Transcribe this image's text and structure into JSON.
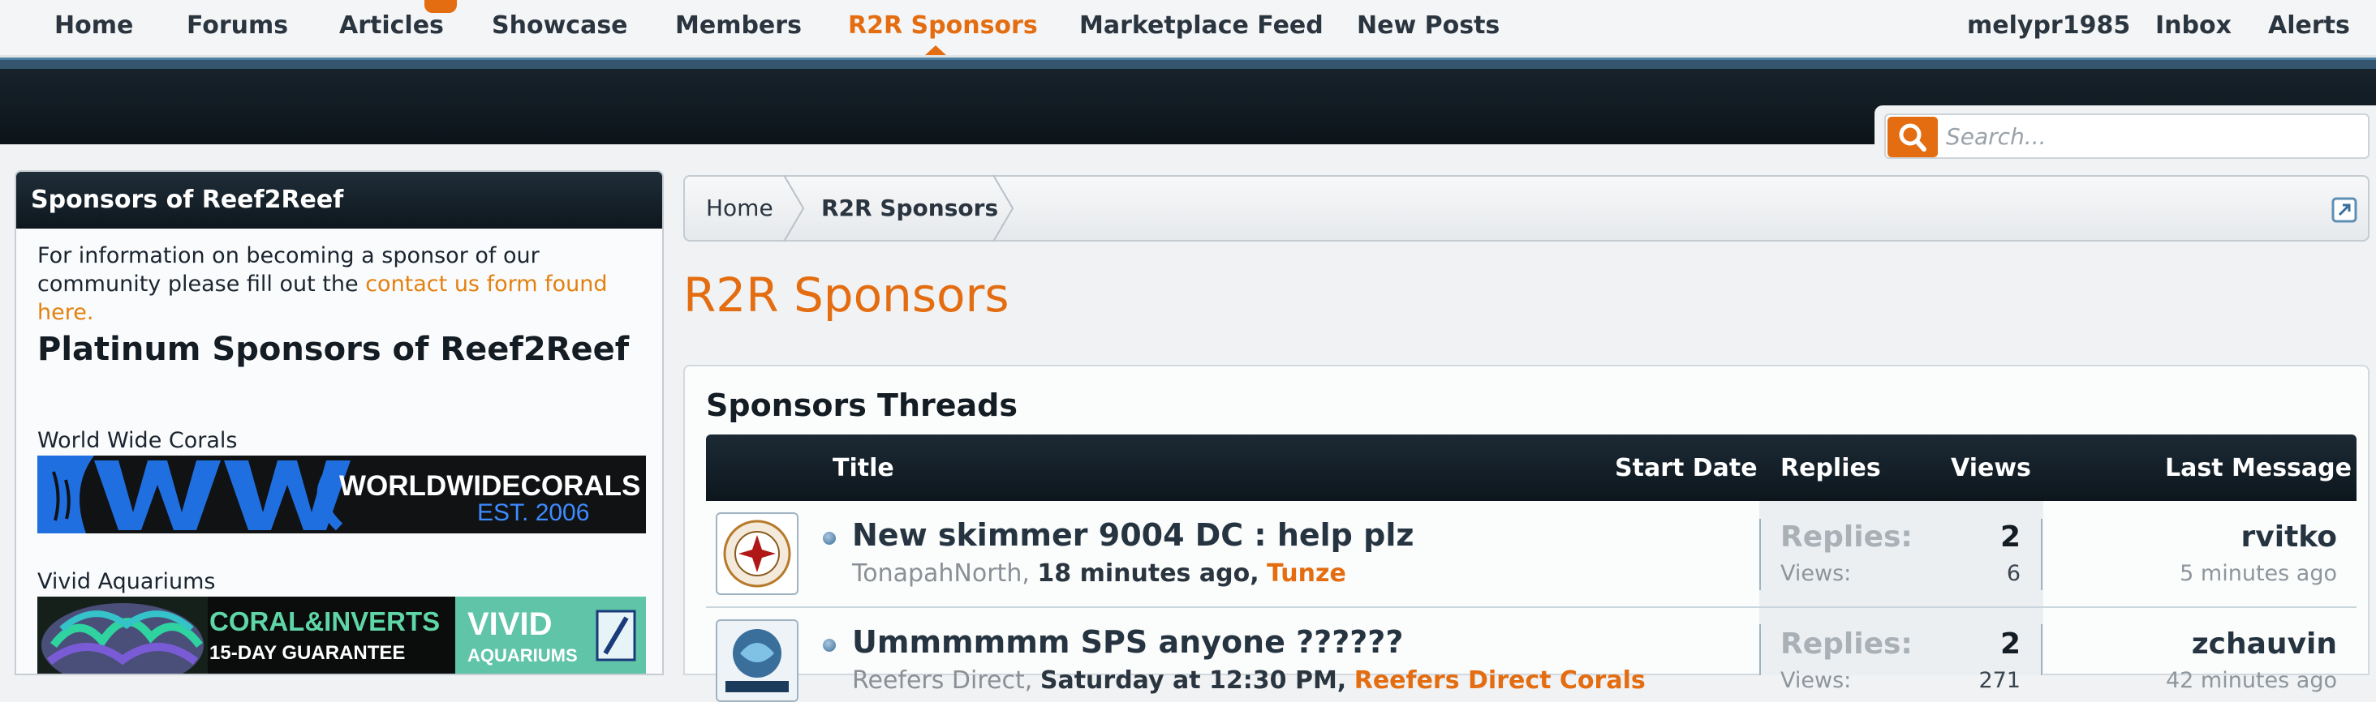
{
  "nav": {
    "items": [
      "Home",
      "Forums",
      "Articles",
      "Showcase",
      "Members",
      "R2R Sponsors",
      "Marketplace Feed",
      "New Posts"
    ],
    "active": "R2R Sponsors",
    "user": "melypr1985",
    "inbox": "Inbox",
    "alerts": "Alerts"
  },
  "search": {
    "placeholder": "Search..."
  },
  "sidebar": {
    "title": "Sponsors of Reef2Reef",
    "info_text": "For information on becoming a sponsor of our community please fill out the",
    "info_link": "contact us form found here.",
    "heading": "Platinum Sponsors of Reef2Reef",
    "sponsors": [
      {
        "name": "World Wide Corals",
        "banner_main": "WORLDWIDECORALS",
        "banner_sub": "EST. 2006"
      },
      {
        "name": "Vivid Aquariums",
        "banner_main": "CORAL&INVERTS",
        "banner_sub": "15-DAY GUARANTEE",
        "brand": "VIVID",
        "brand_sub": "AQUARIUMS"
      }
    ]
  },
  "breadcrumb": {
    "items": [
      "Home",
      "R2R Sponsors"
    ]
  },
  "page_title": "R2R Sponsors",
  "threads": {
    "title": "Sponsors Threads",
    "columns": {
      "title": "Title",
      "start_date": "Start Date",
      "replies": "Replies",
      "views": "Views",
      "last_message": "Last Message"
    },
    "stat_labels": {
      "replies": "Replies:",
      "views": "Views:"
    },
    "rows": [
      {
        "title": "New skimmer 9004 DC : help plz",
        "author": "TonapahNorth,",
        "when": "18 minutes ago,",
        "forum": "Tunze",
        "replies": "2",
        "views": "6",
        "last_user": "rvitko",
        "last_time": "5 minutes ago"
      },
      {
        "title": "Ummmmmm SPS anyone ??????",
        "author": "Reefers Direct,",
        "when": "Saturday at 12:30 PM,",
        "forum": "Reefers Direct Corals",
        "replies": "2",
        "views": "271",
        "last_user": "zchauvin",
        "last_time": "42 minutes ago"
      }
    ]
  },
  "colors": {
    "accent": "#e36d10",
    "header_dark": "#0e171e",
    "link": "#e3800f"
  }
}
